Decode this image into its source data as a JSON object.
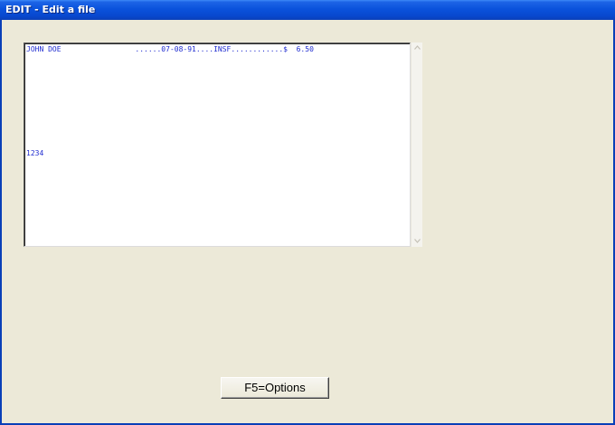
{
  "window": {
    "title": "EDIT - Edit a file"
  },
  "editor": {
    "lines": [
      "JOHN DOE                 ......07-08-91....INSF............$  6.50",
      "1234"
    ],
    "text_color": "#1f2cd0"
  },
  "scrollbar": {
    "up_icon": "chevron-up-icon",
    "down_icon": "chevron-down-icon"
  },
  "footer": {
    "options_label": "F5=Options"
  },
  "colors": {
    "titlebar": "#0a52dc",
    "window_bg": "#ece9d8"
  }
}
